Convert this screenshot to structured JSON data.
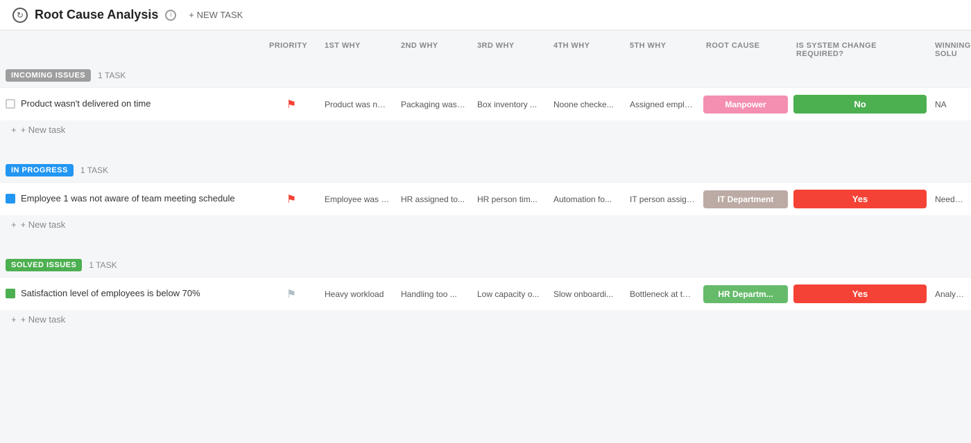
{
  "header": {
    "title": "Root Cause Analysis",
    "new_task_label": "+ NEW TASK",
    "back_icon": "←"
  },
  "columns": [
    "",
    "PRIORITY",
    "1ST WHY",
    "2ND WHY",
    "3RD WHY",
    "4TH WHY",
    "5TH WHY",
    "ROOT CAUSE",
    "IS SYSTEM CHANGE REQUIRED?",
    "WINNING SOLU"
  ],
  "sections": [
    {
      "id": "incoming",
      "badge": "INCOMING ISSUES",
      "badge_class": "badge-incoming",
      "task_count": "1 TASK",
      "tasks": [
        {
          "name": "Product wasn't delivered on time",
          "checkbox_class": "",
          "priority_flag": "red",
          "why1": "Product was not rea...",
          "why2": "Packaging was ...",
          "why3": "Box inventory ...",
          "why4": "Noone checke...",
          "why5": "Assigned employ...",
          "root_cause": "Manpower",
          "root_cause_class": "rc-manpower",
          "system_change": "No",
          "system_change_class": "sc-no",
          "winning_solution": "NA"
        }
      ],
      "add_task_label": "+ New task"
    },
    {
      "id": "inprogress",
      "badge": "IN PROGRESS",
      "badge_class": "badge-inprogress",
      "task_count": "1 TASK",
      "tasks": [
        {
          "name": "Employee 1 was not aware of team meeting schedule",
          "checkbox_class": "blue",
          "priority_flag": "red",
          "why1": "Employee was not b...",
          "why2": "HR assigned to...",
          "why3": "HR person tim...",
          "why4": "Automation fo...",
          "why5": "IT person assigne...",
          "root_cause": "IT Department",
          "root_cause_class": "rc-it",
          "system_change": "Yes",
          "system_change_class": "sc-yes",
          "winning_solution": "Need to try us ing Integroma..."
        }
      ],
      "add_task_label": "+ New task"
    },
    {
      "id": "solved",
      "badge": "SOLVED ISSUES",
      "badge_class": "badge-solved",
      "task_count": "1 TASK",
      "tasks": [
        {
          "name": "Satisfaction level of employees is below 70%",
          "checkbox_class": "green",
          "priority_flag": "light",
          "why1": "Heavy workload",
          "why2": "Handling too ...",
          "why3": "Low capacity o...",
          "why4": "Slow onboardi...",
          "why5": "Bottleneck at the...",
          "root_cause": "HR Departm...",
          "root_cause_class": "rc-hr",
          "system_change": "Yes",
          "system_change_class": "sc-yes",
          "winning_solution": "Analyze the cause of bottl..."
        }
      ],
      "add_task_label": "+ New task"
    }
  ]
}
